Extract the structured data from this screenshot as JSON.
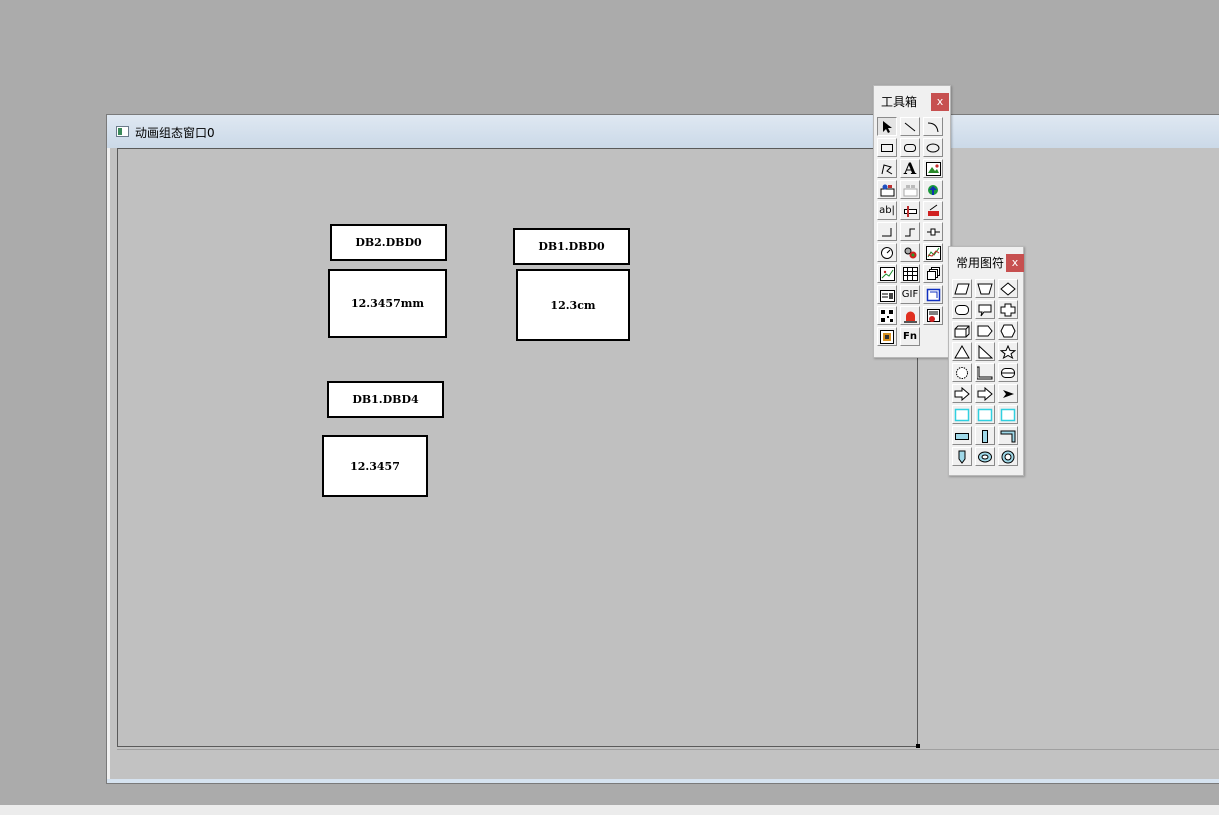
{
  "window": {
    "title": "动画组态窗口0"
  },
  "canvas": {
    "boxes": [
      {
        "id": "db2-dbd0-label",
        "text": "DB2.DBD0"
      },
      {
        "id": "db2-dbd0-value",
        "text": "12.3457mm"
      },
      {
        "id": "db1-dbd0-label",
        "text": "DB1.DBD0"
      },
      {
        "id": "db1-dbd0-value",
        "text": "12.3cm"
      },
      {
        "id": "db1-dbd4-label",
        "text": "DB1.DBD4"
      },
      {
        "id": "db1-dbd4-value",
        "text": "12.3457"
      }
    ]
  },
  "toolbox": {
    "title": "工具箱",
    "close": "x",
    "tools": [
      "pointer-tool",
      "line-tool",
      "arc-tool",
      "rectangle-tool",
      "rounded-rect-tool",
      "ellipse-tool",
      "polyline-tool",
      "label-tool",
      "bitmap-tool",
      "symbol-lib-tool",
      "component-lib-tool",
      "insert-element-tool",
      "input-box-tool",
      "slider-tool",
      "switch-tool",
      "pipe-tool",
      "flow-tool",
      "valve-tool",
      "gauge-tool",
      "indicator-tool",
      "trend-chart-tool",
      "history-chart-tool",
      "table-tool",
      "subwindow-tool",
      "report-tool",
      "gif-tool",
      "frame-tool",
      "qrcode-tool",
      "alarm-light-tool",
      "alarm-display-tool",
      "image-tool",
      "fn-tool"
    ],
    "gif_label": "GIF",
    "fn_label": "Fn",
    "label_glyph": "A",
    "input_glyph": "ab|"
  },
  "symbols": {
    "title": "常用图符",
    "close": "x",
    "items": [
      "parallelogram-icon",
      "trapezoid-icon",
      "diamond-icon",
      "octagon-icon",
      "callout-icon",
      "cross-icon",
      "cube-icon",
      "pentagon-arrow-icon",
      "hexagon-icon",
      "triangle-icon",
      "right-triangle-icon",
      "star-icon",
      "burst-icon",
      "elbow-icon",
      "cylinder-icon",
      "arrow-right-icon",
      "arrow-right2-icon",
      "pointer-arrow-icon",
      "cyan-frame1-icon",
      "cyan-frame2-icon",
      "cyan-frame3-icon",
      "h-bar-icon",
      "v-bar-icon",
      "corner-icon",
      "pencil-icon",
      "ring-icon",
      "donut-icon"
    ]
  }
}
